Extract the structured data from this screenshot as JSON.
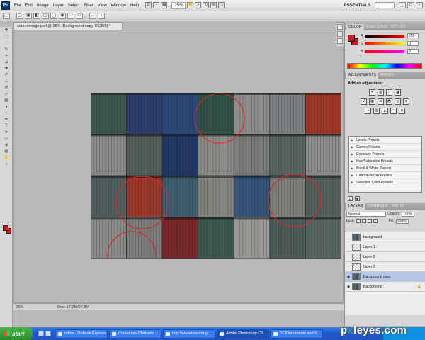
{
  "app": {
    "logo": "Ps",
    "menu": [
      "File",
      "Edit",
      "Image",
      "Layer",
      "Select",
      "Filter",
      "View",
      "Window",
      "Help"
    ],
    "zoom": "25%",
    "workspace": "ESSENTIALS",
    "window_controls": [
      "_",
      "□",
      "×"
    ]
  },
  "document": {
    "tab_title": "sourceimage.psd @ 25% (Background copy, RGB/8) *",
    "status_zoom": "25%",
    "status_info": "Doc: 17.2M/64.8M"
  },
  "canvas": {
    "rows": [
      [
        "#3d5a4f",
        "#2c3f6e",
        "#2b4a7a",
        "#33524a",
        "#8e8d8b",
        "#7d8082",
        "#a03a2a"
      ],
      [
        "#8a8b8a",
        "#55605c",
        "#243a66",
        "#8d8c89",
        "#7a7d7b",
        "#5a6663",
        "#8e8e8c"
      ],
      [
        "#52615f",
        "#9a3a2d",
        "#3f5f72",
        "#86847f",
        "#34547a",
        "#7f7e7b",
        "#56625f"
      ],
      [
        "#8c8c8a",
        "#7e7f7d",
        "#7a2a2a",
        "#3d5a50",
        "#9a9996",
        "#4f5d5a",
        "#5a6864"
      ]
    ],
    "circle_color": "#d22a2a"
  },
  "colors": {
    "foreground": "#d9141a",
    "background": "#d9141a"
  },
  "color_panel": {
    "tabs": [
      "COLOR",
      "SWATCHES",
      "STYLES"
    ],
    "rows": [
      {
        "label": "R",
        "value": "255"
      },
      {
        "label": "G",
        "value": "0"
      },
      {
        "label": "B",
        "value": "0"
      }
    ]
  },
  "adjustments_panel": {
    "tabs": [
      "ADJUSTMENTS",
      "MASKS"
    ],
    "title": "Add an adjustment",
    "presets": [
      "Levels Presets",
      "Curves Presets",
      "Exposure Presets",
      "Hue/Saturation Presets",
      "Black & White Presets",
      "Channel Mixer Presets",
      "Selective Color Presets"
    ]
  },
  "layers_panel": {
    "tabs": [
      "LAYERS",
      "CHANNELS",
      "PATHS"
    ],
    "blend_mode": "Normal",
    "opacity_label": "Opacity:",
    "opacity": "100%",
    "lock_label": "Lock:",
    "fill_label": "Fill:",
    "fill": "100%",
    "layers": [
      {
        "name": "background",
        "visible": false,
        "thumb": "photo",
        "selected": false,
        "italic": false
      },
      {
        "name": "Layer 1",
        "visible": false,
        "thumb": "transparent",
        "selected": false,
        "italic": false
      },
      {
        "name": "Layer 2",
        "visible": false,
        "thumb": "transparent",
        "selected": false,
        "italic": false
      },
      {
        "name": "Layer 3",
        "visible": false,
        "thumb": "transparent",
        "selected": false,
        "italic": false
      },
      {
        "name": "Background copy",
        "visible": true,
        "thumb": "photo",
        "selected": true,
        "italic": false
      },
      {
        "name": "Background",
        "visible": true,
        "thumb": "photo",
        "selected": false,
        "italic": true,
        "locked": true
      }
    ]
  },
  "taskbar": {
    "start_label": "start",
    "tasks": [
      "Inbox - Outlook Express",
      "Containers Photosho...",
      "http://www.maironi-g...",
      "Adobe Photoshop CS...",
      "\"C:\\Documents and S..."
    ],
    "active_task": 3
  },
  "watermark": {
    "prefix": "p",
    "x": "x",
    "rest": "leyes.com"
  }
}
